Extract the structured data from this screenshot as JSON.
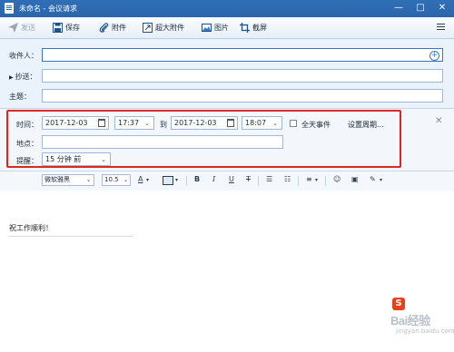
{
  "window": {
    "title": "未命名 - 会议请求"
  },
  "toolbar": {
    "send": "发送",
    "save": "保存",
    "attach": "附件",
    "large_attach": "超大附件",
    "image": "图片",
    "screenshot": "截屏"
  },
  "header": {
    "to_label": "收件人：",
    "cc_label": "抄送：",
    "subject_label": "主题："
  },
  "meeting": {
    "time_label": "时间：",
    "start_date": "2017-12-03",
    "start_time": "17:37",
    "to_label": "到",
    "end_date": "2017-12-03",
    "end_time": "18:07",
    "allday_label": "全天事件",
    "recurrence_label": "设置周期...",
    "location_label": "地点：",
    "reminder_label": "提醒：",
    "reminder_value": "15 分钟 前"
  },
  "format": {
    "font": "微软雅黑",
    "size": "10.5"
  },
  "body": {
    "text": "祝工作顺利！"
  },
  "watermark": {
    "brand": "Bai经验",
    "url": "jingyan.baidu.com"
  },
  "colors": {
    "titlebar": "#2f6fb6",
    "highlight": "#e02525",
    "accent": "#3a78c0"
  }
}
